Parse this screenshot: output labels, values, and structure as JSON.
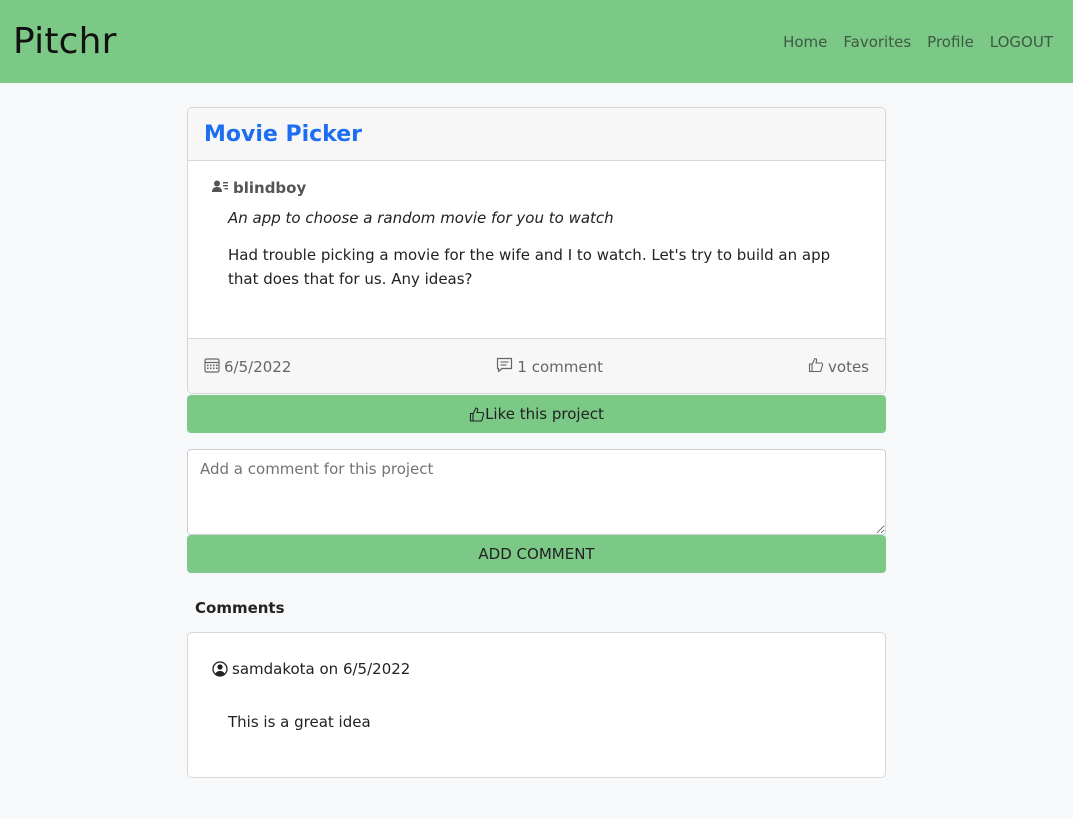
{
  "navbar": {
    "brand": "Pitchr",
    "links": [
      "Home",
      "Favorites",
      "Profile",
      "LOGOUT"
    ]
  },
  "project": {
    "title": "Movie Picker",
    "author": "blindboy",
    "tagline": "An app to choose a random movie for you to watch",
    "description": "Had trouble picking a movie for the wife and I to watch. Let's try to build an app that does that for us. Any ideas?",
    "date": "6/5/2022",
    "comment_count": "1 comment",
    "votes": "votes"
  },
  "actions": {
    "like_label": "Like this project",
    "comment_placeholder": "Add a comment for this project",
    "add_comment_label": "ADD COMMENT"
  },
  "comments": {
    "heading": "Comments",
    "items": [
      {
        "meta": "samdakota on 6/5/2022",
        "text": "This is a great idea"
      }
    ]
  },
  "colors": {
    "accent_green": "#7bc887",
    "title_blue": "#1d6ef2"
  },
  "icons": {
    "author": "person-lines-icon",
    "date": "calendar-icon",
    "comments": "chat-icon",
    "votes": "thumbs-up-icon",
    "commenter": "person-circle-icon"
  }
}
